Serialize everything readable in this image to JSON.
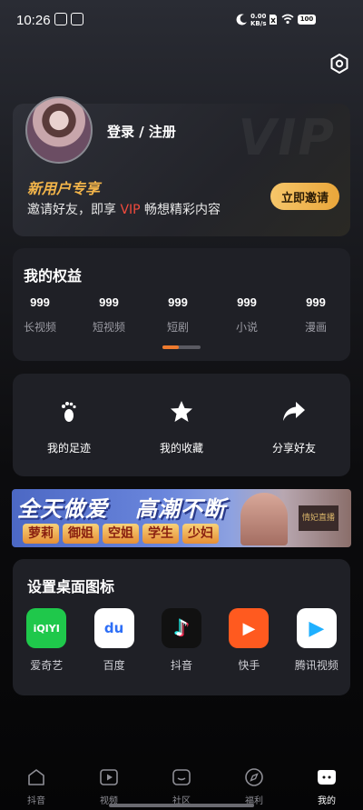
{
  "status_bar": {
    "time": "10:26",
    "net_speed_value": "0.00",
    "net_speed_unit": "KB/s",
    "battery": "100"
  },
  "profile": {
    "login_text": "登录 / 注册",
    "watermark": "VIP",
    "promo_title": "新用户专享",
    "invite_prefix": "邀请好友，即享 ",
    "invite_vip": "VIP",
    "invite_suffix": " 畅想精彩内容",
    "invite_button": "立即邀请"
  },
  "rights": {
    "title": "我的权益",
    "items": [
      {
        "value": "999",
        "label": "长视频"
      },
      {
        "value": "999",
        "label": "短视频"
      },
      {
        "value": "999",
        "label": "短剧"
      },
      {
        "value": "999",
        "label": "小说"
      },
      {
        "value": "999",
        "label": "漫画"
      }
    ]
  },
  "actions": [
    {
      "label": "我的足迹",
      "icon": "footprint-icon"
    },
    {
      "label": "我的收藏",
      "icon": "star-icon"
    },
    {
      "label": "分享好友",
      "icon": "share-icon"
    }
  ],
  "banner": {
    "headline_1": "全天做爱",
    "headline_2": "高潮不断",
    "tags": [
      "萝莉",
      "御姐",
      "空姐",
      "学生",
      "少妇"
    ],
    "sign": "情妃直播"
  },
  "desktop_icons": {
    "title": "设置桌面图标",
    "apps": [
      {
        "label": "爱奇艺",
        "glyph": "iQIYI",
        "color": "#1fc84b"
      },
      {
        "label": "百度",
        "glyph": "du",
        "color": "#2d6ef6"
      },
      {
        "label": "抖音",
        "glyph": "♪",
        "color": "#111111"
      },
      {
        "label": "快手",
        "glyph": "▶",
        "color": "#ff5a1f"
      },
      {
        "label": "腾讯视频",
        "glyph": "▶",
        "color": "#ffffff"
      }
    ]
  },
  "tab_bar": {
    "tabs": [
      {
        "label": "抖音",
        "icon": "home-icon"
      },
      {
        "label": "视频",
        "icon": "video-icon"
      },
      {
        "label": "社区",
        "icon": "community-icon"
      },
      {
        "label": "福利",
        "icon": "compass-icon"
      },
      {
        "label": "我的",
        "icon": "profile-icon",
        "active": true
      }
    ]
  }
}
